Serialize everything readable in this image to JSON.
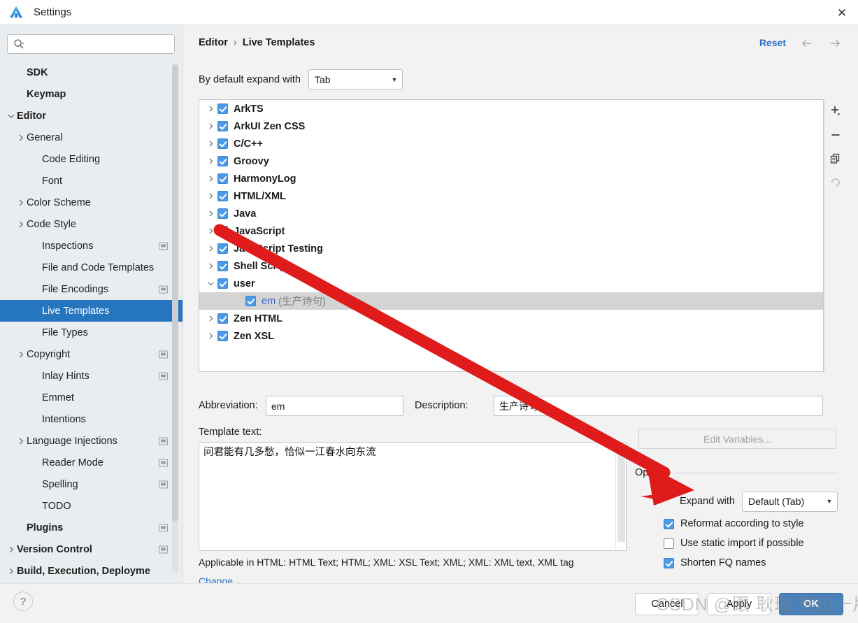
{
  "window": {
    "title": "Settings",
    "logo_icon": "deveco-logo-icon",
    "close_icon": "close-icon"
  },
  "sidebar": {
    "search": {
      "placeholder": "",
      "value": "",
      "icon": "search-icon"
    },
    "items": [
      {
        "label": "SDK",
        "indent": 1,
        "bold": true,
        "arrow": "none",
        "badge": false
      },
      {
        "label": "Keymap",
        "indent": 1,
        "bold": true,
        "arrow": "none",
        "badge": false
      },
      {
        "label": "Editor",
        "indent": 0,
        "bold": true,
        "arrow": "down",
        "badge": false
      },
      {
        "label": "General",
        "indent": 1,
        "bold": false,
        "arrow": "right",
        "badge": false
      },
      {
        "label": "Code Editing",
        "indent": 2,
        "bold": false,
        "arrow": "none",
        "badge": false
      },
      {
        "label": "Font",
        "indent": 2,
        "bold": false,
        "arrow": "none",
        "badge": false
      },
      {
        "label": "Color Scheme",
        "indent": 1,
        "bold": false,
        "arrow": "right",
        "badge": false
      },
      {
        "label": "Code Style",
        "indent": 1,
        "bold": false,
        "arrow": "right",
        "badge": false
      },
      {
        "label": "Inspections",
        "indent": 2,
        "bold": false,
        "arrow": "none",
        "badge": true
      },
      {
        "label": "File and Code Templates",
        "indent": 2,
        "bold": false,
        "arrow": "none",
        "badge": false
      },
      {
        "label": "File Encodings",
        "indent": 2,
        "bold": false,
        "arrow": "none",
        "badge": true
      },
      {
        "label": "Live Templates",
        "indent": 2,
        "bold": false,
        "arrow": "none",
        "badge": false,
        "selected": true
      },
      {
        "label": "File Types",
        "indent": 2,
        "bold": false,
        "arrow": "none",
        "badge": false
      },
      {
        "label": "Copyright",
        "indent": 1,
        "bold": false,
        "arrow": "right",
        "badge": true
      },
      {
        "label": "Inlay Hints",
        "indent": 2,
        "bold": false,
        "arrow": "none",
        "badge": true
      },
      {
        "label": "Emmet",
        "indent": 2,
        "bold": false,
        "arrow": "none",
        "badge": false
      },
      {
        "label": "Intentions",
        "indent": 2,
        "bold": false,
        "arrow": "none",
        "badge": false
      },
      {
        "label": "Language Injections",
        "indent": 1,
        "bold": false,
        "arrow": "right",
        "badge": true
      },
      {
        "label": "Reader Mode",
        "indent": 2,
        "bold": false,
        "arrow": "none",
        "badge": true
      },
      {
        "label": "Spelling",
        "indent": 2,
        "bold": false,
        "arrow": "none",
        "badge": true
      },
      {
        "label": "TODO",
        "indent": 2,
        "bold": false,
        "arrow": "none",
        "badge": false
      },
      {
        "label": "Plugins",
        "indent": 1,
        "bold": true,
        "arrow": "none",
        "badge": true
      },
      {
        "label": "Version Control",
        "indent": 0,
        "bold": true,
        "arrow": "right",
        "badge": true
      },
      {
        "label": "Build, Execution, Deployme",
        "indent": 0,
        "bold": true,
        "arrow": "right",
        "badge": false
      }
    ]
  },
  "header": {
    "breadcrumb": {
      "parent": "Editor",
      "separator": "›",
      "current": "Live Templates"
    },
    "reset_label": "Reset",
    "back_icon": "arrow-left-icon",
    "forward_icon": "arrow-right-icon"
  },
  "expand_row": {
    "label": "By default expand with",
    "value": "Tab"
  },
  "tree": {
    "rows": [
      {
        "label": "ArkTS",
        "arrow": "right",
        "checked": true,
        "child": false
      },
      {
        "label": "ArkUI Zen CSS",
        "arrow": "right",
        "checked": true,
        "child": false
      },
      {
        "label": "C/C++",
        "arrow": "right",
        "checked": true,
        "child": false
      },
      {
        "label": "Groovy",
        "arrow": "right",
        "checked": true,
        "child": false
      },
      {
        "label": "HarmonyLog",
        "arrow": "right",
        "checked": true,
        "child": false
      },
      {
        "label": "HTML/XML",
        "arrow": "right",
        "checked": true,
        "child": false
      },
      {
        "label": "Java",
        "arrow": "right",
        "checked": true,
        "child": false
      },
      {
        "label": "JavaScript",
        "arrow": "right",
        "checked": true,
        "child": false
      },
      {
        "label": "JavaScript Testing",
        "arrow": "right",
        "checked": true,
        "child": false
      },
      {
        "label": "Shell Script",
        "arrow": "right",
        "checked": true,
        "child": false
      },
      {
        "label": "user",
        "arrow": "down",
        "checked": true,
        "child": false
      },
      {
        "label": "em",
        "note": "(生产诗句)",
        "arrow": "none",
        "checked": true,
        "child": true,
        "selected": true
      },
      {
        "label": "Zen HTML",
        "arrow": "right",
        "checked": true,
        "child": false
      },
      {
        "label": "Zen XSL",
        "arrow": "right",
        "checked": true,
        "child": false
      }
    ],
    "toolbar": [
      {
        "icon": "add-icon",
        "name": "add-template-button",
        "enabled": true
      },
      {
        "icon": "remove-icon",
        "name": "remove-template-button",
        "enabled": true
      },
      {
        "icon": "copy-icon",
        "name": "duplicate-template-button",
        "enabled": true
      },
      {
        "icon": "revert-icon",
        "name": "revert-template-button",
        "enabled": false
      }
    ]
  },
  "detail": {
    "abbreviation_label": "Abbreviation:",
    "abbreviation_value": "em",
    "description_label": "Description:",
    "description_value": "生产诗句",
    "template_text_label": "Template text:",
    "template_text_value": "问君能有几多愁，恰似一江春水向东流",
    "applicable_text": "Applicable in HTML: HTML Text; HTML; XML: XSL Text; XML; XML: XML text, XML tag",
    "change_label": "Change",
    "change_caret": "⌄",
    "edit_variables_label": "Edit Variables..."
  },
  "options": {
    "title": "Options",
    "expand_with_label": "Expand with",
    "expand_with_value": "Default (Tab)",
    "checks": [
      {
        "label": "Reformat according to style",
        "checked": true
      },
      {
        "label": "Use static import if possible",
        "checked": false
      },
      {
        "label": "Shorten FQ names",
        "checked": true
      }
    ]
  },
  "footer": {
    "help_label": "?",
    "cancel_label": "Cancel",
    "apply_label": "Apply",
    "ok_label": "OK"
  },
  "watermark": {
    "text": "CSDN @跟 耿瑞 卷出一片天"
  },
  "colors": {
    "accent": "#2675bf",
    "link": "#2470c4",
    "ok_button": "#4a81b8",
    "checkbox_on": "#4a9ae8",
    "annotation_arrow": "#e01b1b"
  }
}
